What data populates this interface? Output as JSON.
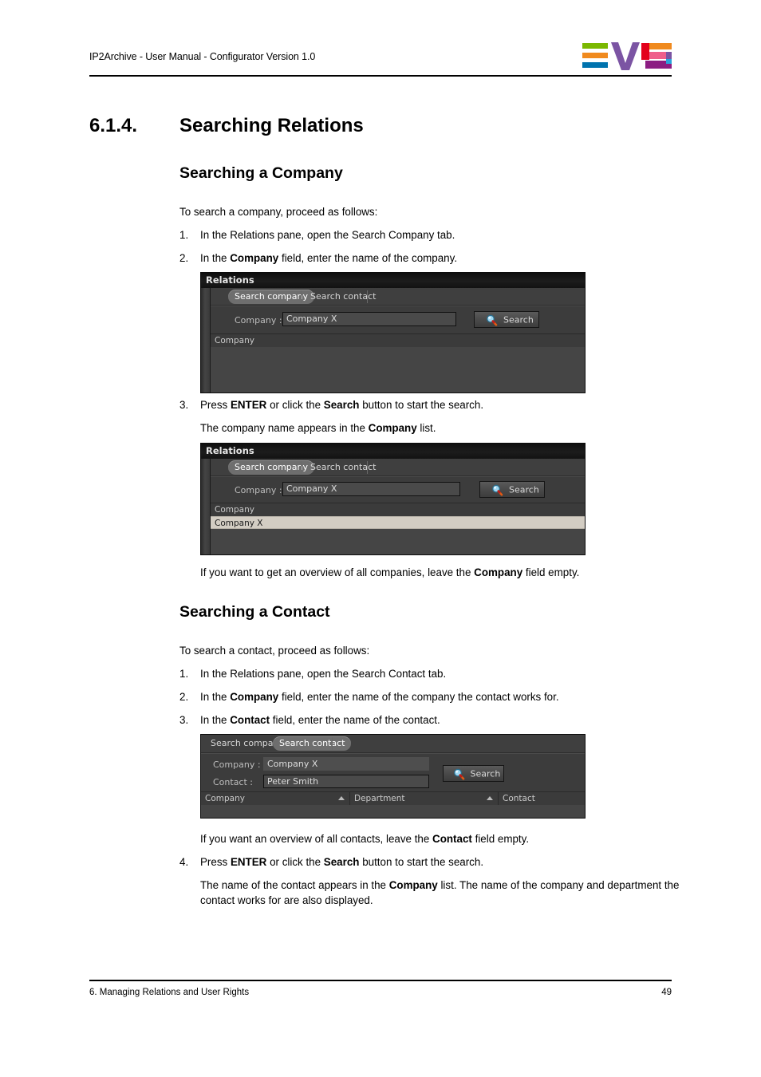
{
  "header": {
    "title": "IP2Archive - User Manual - Configurator Version 1.0",
    "logo_alt": "EVS"
  },
  "footer": {
    "chapter": "6. Managing Relations and User Rights",
    "page": "49"
  },
  "section": {
    "number": "6.1.4.",
    "title": "Searching Relations"
  },
  "company_section": {
    "heading": "Searching a Company",
    "intro": "To search a company, proceed as follows:",
    "steps": [
      {
        "num": "1.",
        "parts": [
          {
            "t": "In the Relations pane, open the Search Company tab.",
            "b": false
          }
        ]
      },
      {
        "num": "2.",
        "parts": [
          {
            "t": "In the ",
            "b": false
          },
          {
            "t": "Company",
            "b": true
          },
          {
            "t": " field, enter the name of the company.",
            "b": false
          }
        ]
      },
      {
        "num": "3.",
        "parts": [
          {
            "t": "Press ",
            "b": false
          },
          {
            "t": "ENTER",
            "b": true
          },
          {
            "t": " or click the ",
            "b": false
          },
          {
            "t": "Search",
            "b": true
          },
          {
            "t": " button to start the search.",
            "b": false
          }
        ]
      }
    ],
    "step3_result": "The company name appears in the Company list.",
    "note": "If you want to get an overview of all companies, leave the Company field empty."
  },
  "contact_section": {
    "heading": "Searching a Contact",
    "intro": "To search a contact, proceed as follows:",
    "steps": [
      {
        "num": "1.",
        "text": "In the Relations pane, open the Search Contact tab."
      },
      {
        "num": "2.",
        "text": "In the Company field, enter the name of the company the contact works for."
      },
      {
        "num": "3.",
        "text": "In the Contact field, enter the name of the contact."
      },
      {
        "num": "4.",
        "text": "Press ENTER or click the Search button to start the search."
      }
    ],
    "note": "If you want an overview of all contacts, leave the Contact field empty.",
    "step4_result": "The name of the contact appears in the Company list. The name of the company and department the contact works for are also displayed."
  },
  "screenshot1": {
    "window_title": "Relations",
    "tabs": [
      {
        "label": "Search company",
        "active": true
      },
      {
        "label": "Search contact",
        "active": false
      }
    ],
    "company_label": "Company :",
    "company_value": "Company X",
    "search_button": "Search",
    "search_icon": "magnifier-icon",
    "grid_headers": [
      "Company"
    ],
    "grid_rows": []
  },
  "screenshot2": {
    "window_title": "Relations",
    "tabs": [
      {
        "label": "Search company",
        "active": true
      },
      {
        "label": "Search contact",
        "active": false
      }
    ],
    "company_label": "Company :",
    "company_value": "Company X",
    "search_button": "Search",
    "search_icon": "magnifier-icon",
    "grid_headers": [
      "Company"
    ],
    "grid_rows": [
      {
        "company": "Company X",
        "selected": true
      }
    ]
  },
  "screenshot3": {
    "tabs": [
      {
        "label": "Search company",
        "active": false
      },
      {
        "label": "Search contact",
        "active": true
      }
    ],
    "company_label": "Company :",
    "company_value": "Company X",
    "contact_label": "Contact :",
    "contact_value": "Peter Smith",
    "search_button": "Search",
    "search_icon": "magnifier-icon",
    "grid_headers": [
      "Company",
      "Department",
      "Contact"
    ],
    "grid_rows": []
  },
  "colors": {
    "logo_green": "#7ab800",
    "logo_orange": "#f08a1e",
    "logo_blue": "#0073ae",
    "logo_purple": "#7b54a3",
    "logo_red": "#e3001b",
    "logo_pink": "#ef5f8c",
    "logo_magenta": "#8c1d82",
    "logo_cyan": "#29a3dc",
    "selection_row": "#d3cdc3",
    "panel_bg": "#3a3a3a"
  }
}
